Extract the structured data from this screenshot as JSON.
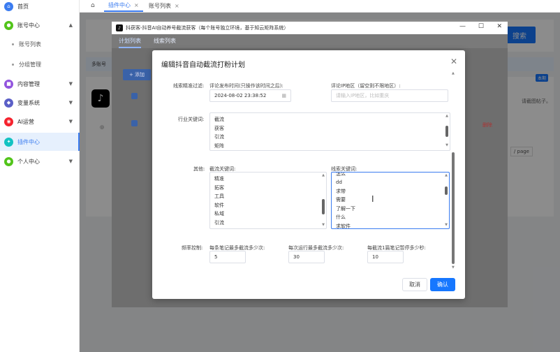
{
  "sidebar": {
    "home": "首页",
    "account_center": "账号中心",
    "account_list": "账号列表",
    "group_manage": "分组管理",
    "content_manage": "内容管理",
    "variable_system": "变量系统",
    "ai_ops": "AI运营",
    "plugin_center": "插件中心",
    "personal_center": "个人中心"
  },
  "tabs": [
    {
      "label": "插件中心"
    },
    {
      "label": "账号列表"
    }
  ],
  "background": {
    "search_btn": "搜索",
    "account_note": "多账号",
    "add_btn": "+ 添加",
    "page_size": "/ page",
    "right_badge": "本期",
    "right_text": "请截图帖子。",
    "danger_text": "删除"
  },
  "window": {
    "title": "抖获客-抖音AI自动养号截流获客（每个账号独立环境，基于知云矩阵系统）",
    "tab_plan": "计划列表",
    "tab_leads": "线索列表"
  },
  "dialog": {
    "title": "编辑抖音自动截流打粉计划",
    "precise_filter_label": "线索精准过滤:",
    "comment_time_label": "评论发布时间(只操作该时间之后):",
    "comment_time_value": "2024-08-02 23:38:52",
    "ip_label": "评论IP地区（留空则不限地区）:",
    "ip_placeholder": "请输入IP地区，比如重庆",
    "industry_label": "行业关键词:",
    "industry_keywords": [
      "截流",
      "获客",
      "引流",
      "矩阵"
    ],
    "other_label": "其他:",
    "intercept_label": "截流关键词:",
    "intercept_keywords": [
      "精准",
      "拓客",
      "工具",
      "软件",
      "私域",
      "引流"
    ],
    "leads_label": "线索关键词:",
    "leads_keywords": [
      "怎么",
      "dd",
      "求带",
      "需要",
      "了解一下",
      "什么",
      "求软件"
    ],
    "freq_label": "频率控制:",
    "freq1_label": "每条笔记最多截流多少次:",
    "freq1_value": "5",
    "freq2_label": "每次运行最多截流多少次:",
    "freq2_value": "30",
    "freq3_label": "每截流1篇笔记暂停多少秒:",
    "freq3_value": "10",
    "cancel": "取消",
    "ok": "确认"
  },
  "colors": {
    "accent": "#1677ff"
  }
}
